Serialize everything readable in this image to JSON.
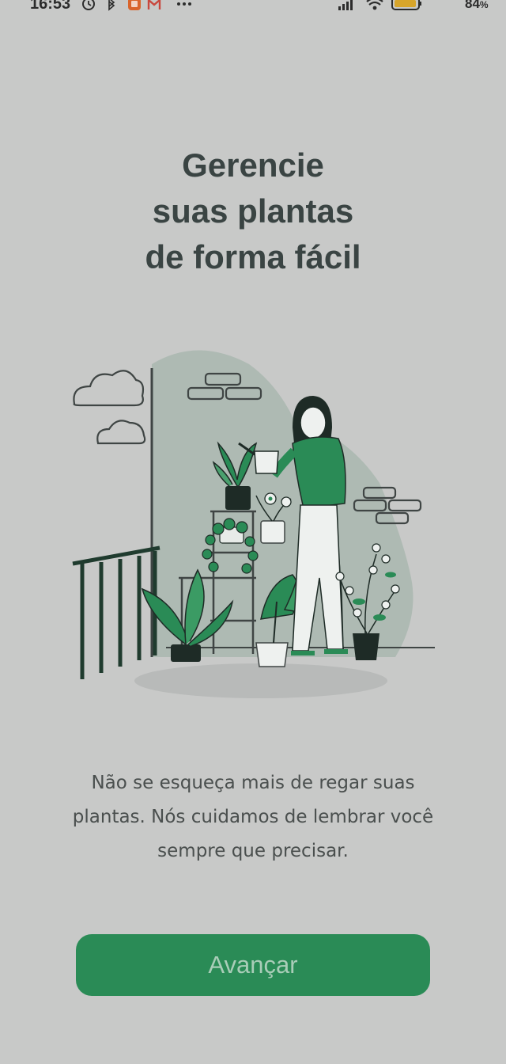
{
  "status_bar": {
    "time": "16:53",
    "battery": "84",
    "battery_unit": "%",
    "icons_left": [
      "alarm-icon",
      "bluetooth-icon",
      "app-notification-icon",
      "gmail-icon",
      "more-dots-icon"
    ],
    "icons_right": [
      "signal-icon",
      "wifi-icon",
      "battery-icon"
    ]
  },
  "onboarding": {
    "title_lines": [
      "Gerencie",
      "suas plantas",
      "de forma fácil"
    ],
    "description_lines": [
      "Não se esqueça mais de regar suas",
      "plantas. Nós cuidamos de lembrar você",
      "sempre que precisar."
    ],
    "button_label": "Avançar"
  },
  "colors": {
    "background": "#c8c9c8",
    "title": "#3a4443",
    "accent_green": "#2a8b56",
    "button_text": "#a9cdb8"
  }
}
